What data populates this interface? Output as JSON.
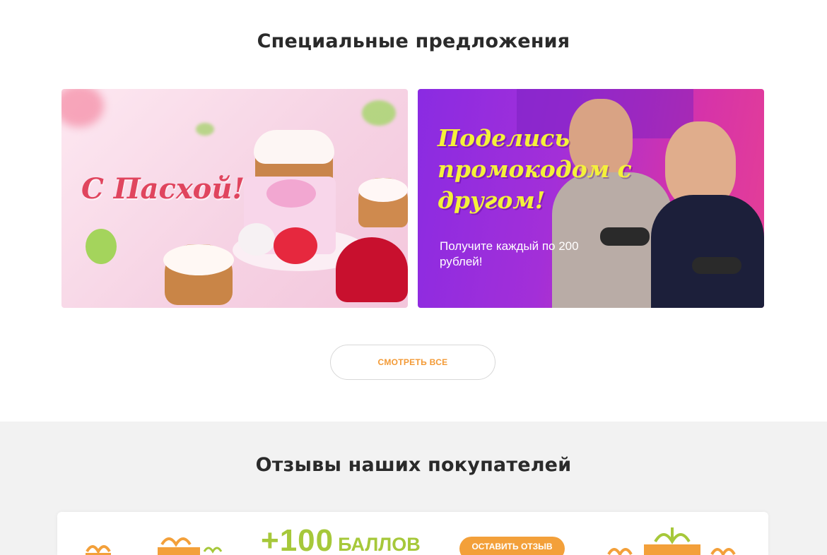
{
  "offers": {
    "title": "Специальные предложения",
    "banners": [
      {
        "text": "С Пасхой!"
      },
      {
        "heading": "Поделись промокодом с другом!",
        "subtext": "Получите каждый по 200 рублей!"
      }
    ],
    "view_all_label": "СМОТРЕТЬ ВСЕ"
  },
  "reviews": {
    "title": "Отзывы наших покупателей",
    "bonus_amount": "+100",
    "bonus_unit": "БАЛЛОВ",
    "leave_review_label": "ОСТАВИТЬ ОТЗЫВ"
  },
  "colors": {
    "accent_orange": "#f39a36",
    "bonus_green": "#a6c83a",
    "promo_yellow": "#f4f13a",
    "easter_red": "#e0455e"
  }
}
